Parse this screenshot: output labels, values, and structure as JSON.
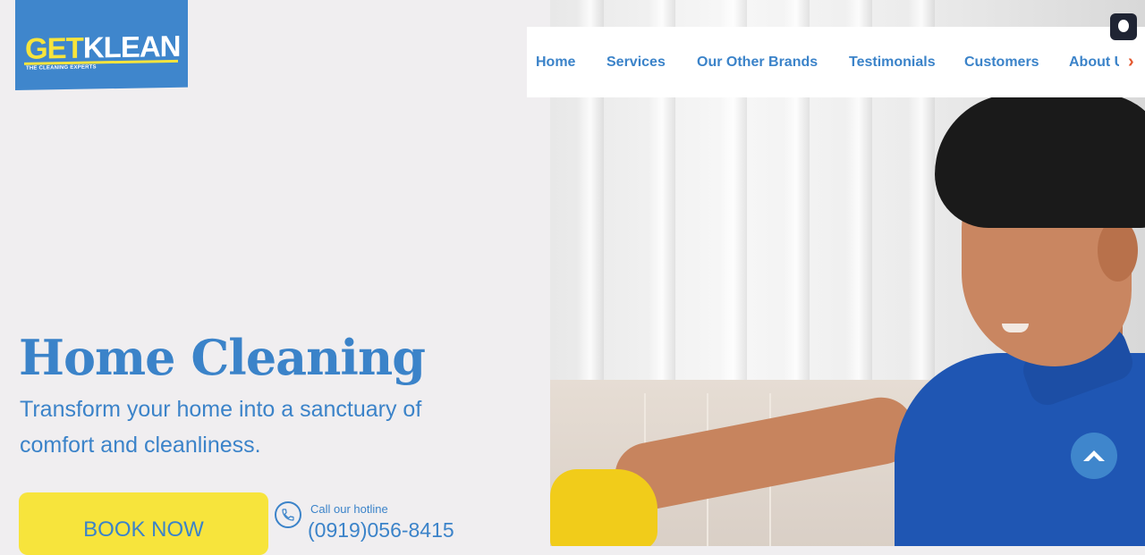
{
  "logo": {
    "part1": "GET",
    "part2": "KLEAN",
    "tagline": "THE CLEANING EXPERTS"
  },
  "nav": {
    "items": [
      "Home",
      "Services",
      "Our Other Brands",
      "Testimonials",
      "Customers",
      "About Us"
    ],
    "more_arrow": "›"
  },
  "hero": {
    "title": "Home Cleaning",
    "subtitle": "Transform your home into a sanctuary of comfort and cleanliness."
  },
  "cta": {
    "book_label": "BOOK NOW"
  },
  "hotline": {
    "label": "Call our hotline",
    "number": "(0919)056-8415"
  },
  "icons": {
    "accessibility": "accessibility-icon",
    "scroll_top": "chevron-up-icon",
    "phone": "phone-icon"
  },
  "colors": {
    "brand_blue": "#3b83c9",
    "brand_yellow": "#f7e43c",
    "background": "#f0eef0"
  }
}
